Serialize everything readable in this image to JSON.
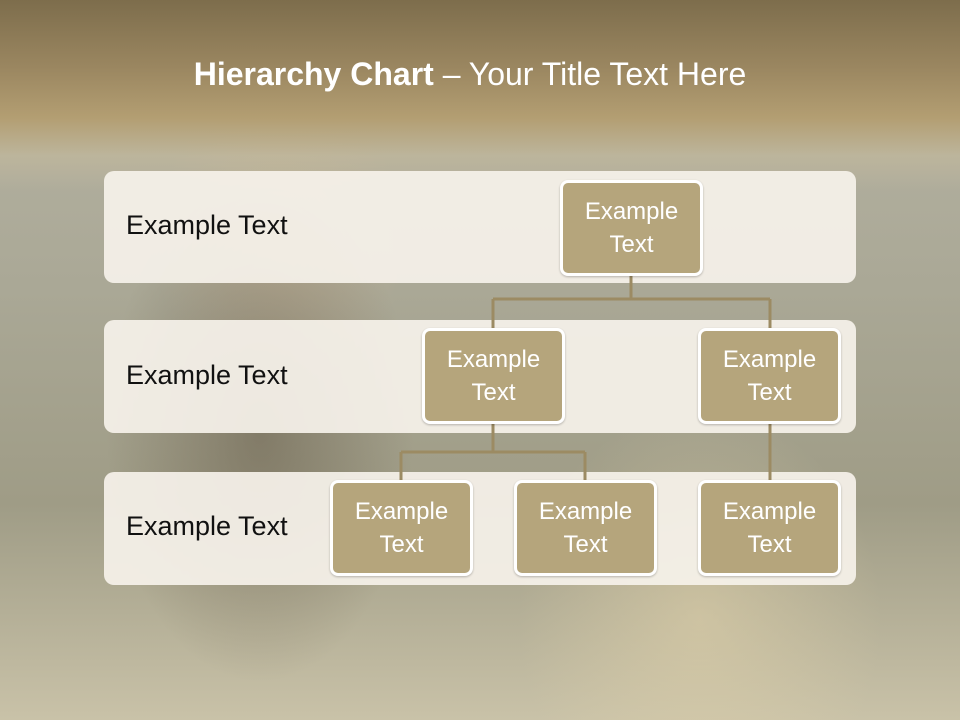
{
  "title": {
    "bold": "Hierarchy Chart",
    "dash": " – ",
    "rest": "Your Title Text Here"
  },
  "levels": [
    {
      "label": "Example Text"
    },
    {
      "label": "Example Text"
    },
    {
      "label": "Example Text"
    }
  ],
  "nodes": [
    {
      "line1": "Example",
      "line2": "Text"
    },
    {
      "line1": "Example",
      "line2": "Text"
    },
    {
      "line1": "Example",
      "line2": "Text"
    },
    {
      "line1": "Example",
      "line2": "Text"
    },
    {
      "line1": "Example",
      "line2": "Text"
    },
    {
      "line1": "Example",
      "line2": "Text"
    }
  ],
  "colors": {
    "node_fill": "#b5a57c",
    "connector": "#9c8b63",
    "band_fill": "#f6f2ea",
    "title_band": "#9a8660"
  }
}
